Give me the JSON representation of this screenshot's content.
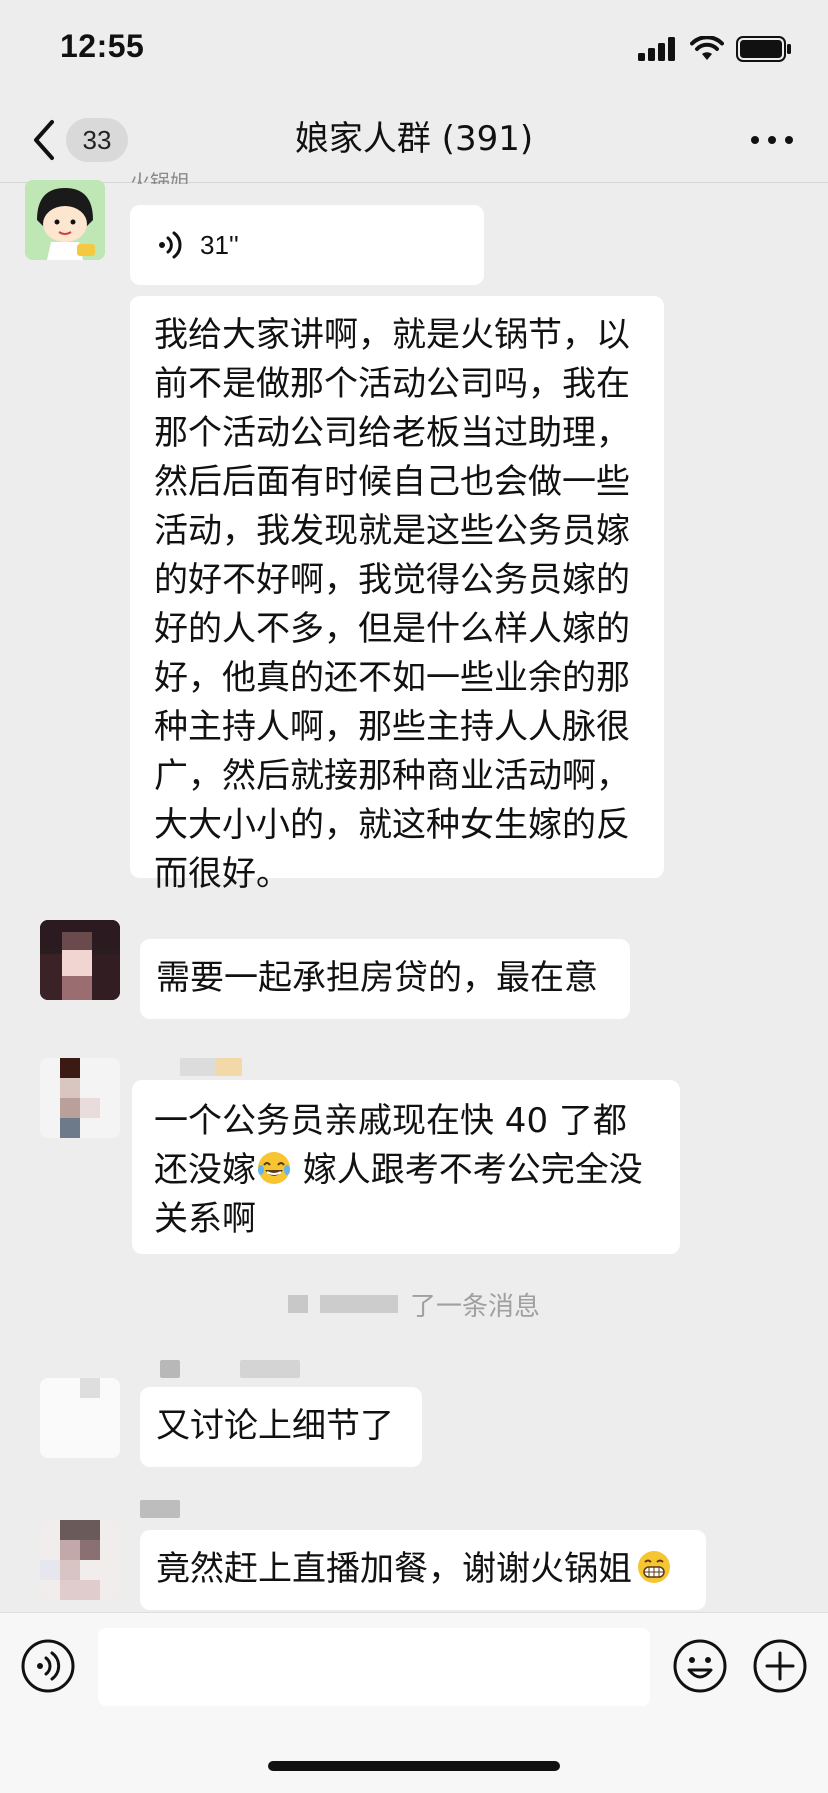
{
  "status_bar": {
    "time": "12:55"
  },
  "nav": {
    "unread_count": "33",
    "title": "娘家人群 (391)"
  },
  "messages": [
    {
      "sender": "火锅姐",
      "voice_duration": "31''",
      "text": "我给大家讲啊，就是火锅节，以前不是做那个活动公司吗，我在那个活动公司给老板当过助理，然后后面有时候自己也会做一些活动，我发现就是这些公务员嫁的好不好啊，我觉得公务员嫁的好的人不多，但是什么样人嫁的好，他真的还不如一些业余的那种主持人啊，那些主持人人脉很广，然后就接那种商业活动啊，大大小小的，就这种女生嫁的反而很好。"
    },
    {
      "text": "需要一起承担房贷的，最在意"
    },
    {
      "text_before_emoji": "一个公务员亲戚现在快 40 了都还没嫁",
      "text_after_emoji": " 嫁人跟考不考公完全没关系啊"
    },
    {
      "text": "又讨论上细节了"
    },
    {
      "text": "竟然赶上直播加餐，谢谢火锅姐"
    }
  ],
  "system_message": {
    "visible_text": "了一条消息"
  },
  "icons": {
    "back": "chevron-left-icon",
    "more": "more-dots-icon",
    "voice": "voice-wave-icon",
    "emoji": "smiley-icon",
    "plus": "plus-circle-icon",
    "laugh_cry": "tears-of-joy-emoji",
    "grin": "grinning-emoji"
  },
  "colors": {
    "background": "#ededed",
    "bubble": "#ffffff",
    "nav_background": "#ededed"
  }
}
